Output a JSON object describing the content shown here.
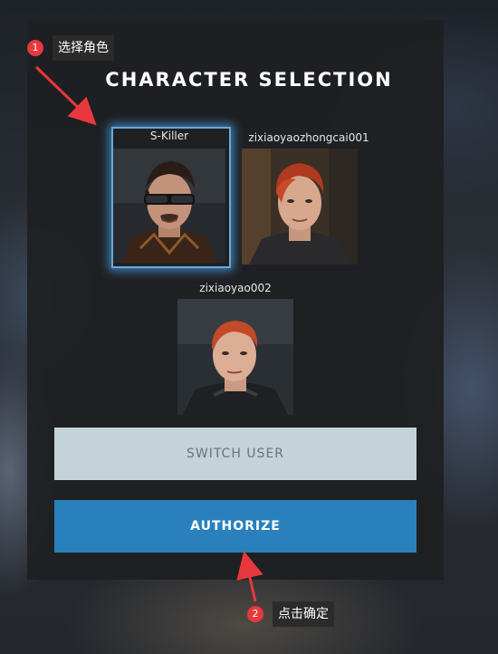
{
  "panel": {
    "title": "CHARACTER SELECTION"
  },
  "characters": [
    {
      "name": "S-Killer",
      "selected": true
    },
    {
      "name": "zixiaoyaozhongcai001",
      "selected": false
    },
    {
      "name": "zixiaoyao002",
      "selected": false
    }
  ],
  "buttons": {
    "switch_user": "SWITCH USER",
    "authorize": "AUTHORIZE"
  },
  "annotations": [
    {
      "number": "1",
      "text": "选择角色"
    },
    {
      "number": "2",
      "text": "点击确定"
    }
  ],
  "colors": {
    "accent": "#2a80bc",
    "switch_bg": "#c4d3da",
    "highlight": "#6aa8d8",
    "annotation": "#e8383d"
  }
}
